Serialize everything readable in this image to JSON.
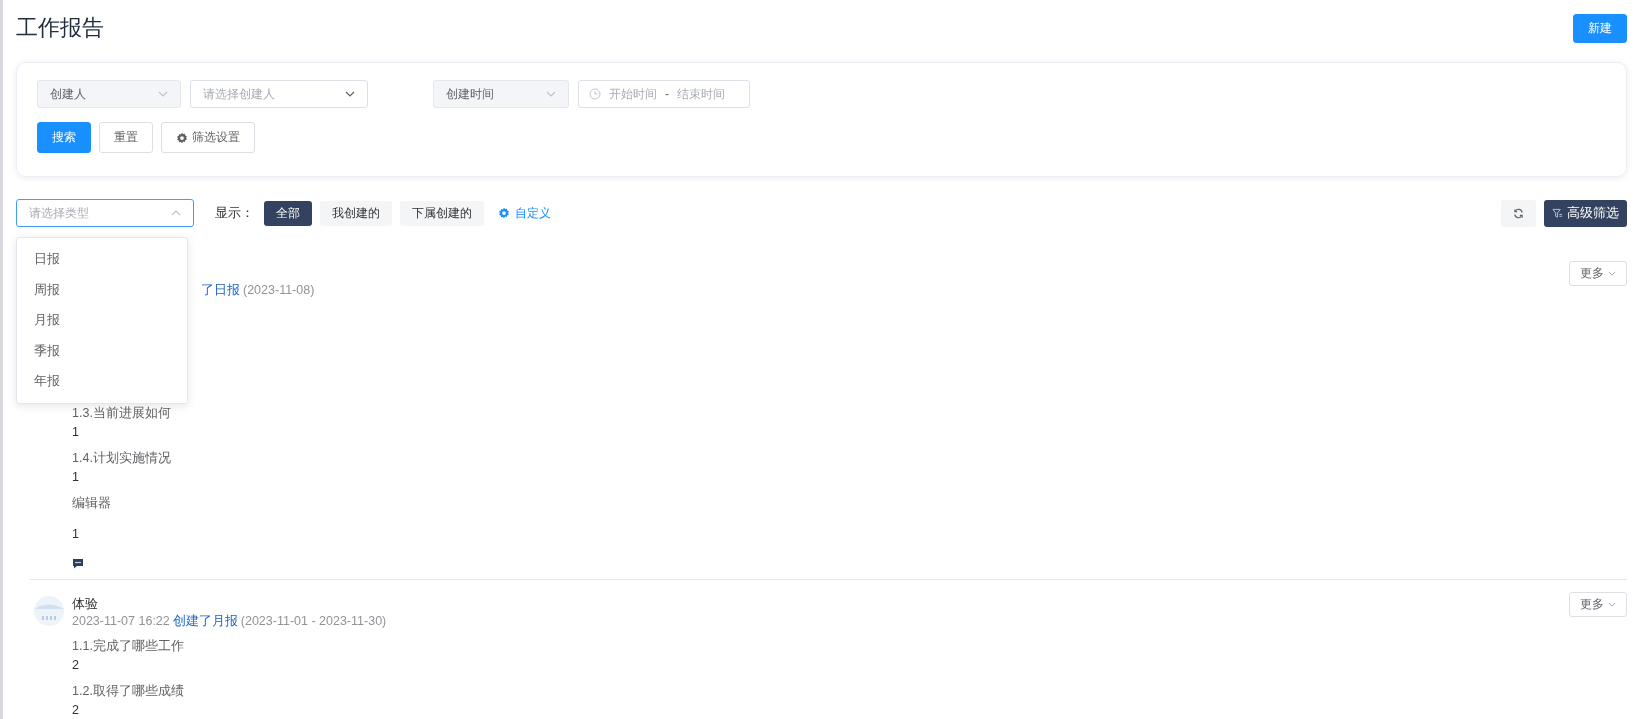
{
  "page_title": "工作报告",
  "new_button": "新建",
  "filters": {
    "creator_field": {
      "label": "创建人"
    },
    "creator_select": {
      "placeholder": "请选择创建人"
    },
    "time_field": {
      "label": "创建时间"
    },
    "date_range": {
      "start_placeholder": "开始时间",
      "separator": "-",
      "end_placeholder": "结束时间"
    },
    "buttons": [
      {
        "label": "搜索",
        "kind": "primary"
      },
      {
        "label": "重置",
        "kind": "default"
      },
      {
        "label": "筛选设置",
        "kind": "settings"
      }
    ]
  },
  "toolbar": {
    "type_select": {
      "placeholder": "请选择类型",
      "expanded": true,
      "options": [
        "日报",
        "周报",
        "月报",
        "季报",
        "年报"
      ]
    },
    "show_label": "显示：",
    "show_tabs": [
      {
        "label": "全部",
        "selected": true
      },
      {
        "label": "我创建的",
        "selected": false
      },
      {
        "label": "下属创建的",
        "selected": false
      }
    ],
    "customize_link": "自定义",
    "advanced_filter": "高级筛选"
  },
  "reports": [
    {
      "action": "了日报",
      "range": "(2023-11-08)",
      "more": "更多",
      "comment": true,
      "fields": [
        {
          "kind": "text",
          "question": "1.3.当前进展如何",
          "answer": "1"
        },
        {
          "kind": "text",
          "question": "1.4.计划实施情况",
          "answer": "1"
        },
        {
          "kind": "editor",
          "question": "编辑器",
          "answer": "1"
        }
      ]
    },
    {
      "author": "体验",
      "time": "2023-11-07 16:22",
      "action": "创建了月报",
      "range": "(2023-11-01 - 2023-11-30)",
      "more": "更多",
      "comment": false,
      "fields": [
        {
          "kind": "text",
          "question": "1.1.完成了哪些工作",
          "answer": "2"
        },
        {
          "kind": "text",
          "question": "1.2.取得了哪些成绩",
          "answer": "2"
        }
      ]
    }
  ]
}
